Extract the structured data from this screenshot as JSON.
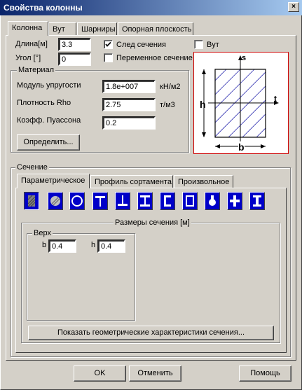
{
  "window": {
    "title": "Свойства колонны",
    "close_glyph": "×"
  },
  "top_tabs": [
    "Колонна",
    "Вут",
    "Шарниры",
    "Опорная плоскость"
  ],
  "column": {
    "length_label": "Длина[м]",
    "length_value": "3.3",
    "angle_label": "Угол [°]",
    "angle_value": "0",
    "trace_label": "След сечения",
    "trace_checked": true,
    "variable_label": "Переменное сечение",
    "variable_checked": false,
    "haunch_label": "Вут",
    "haunch_checked": false
  },
  "material": {
    "title": "Материал",
    "modulus_label": "Модуль упругости",
    "modulus_value": "1.8e+007",
    "modulus_unit": "кН/м2",
    "density_label": "Плотность Rho",
    "density_value": "2.75",
    "density_unit": "т/м3",
    "poisson_label": "Коэфф. Пуассона",
    "poisson_value": "0.2",
    "define_button": "Определить..."
  },
  "preview": {
    "h_label": "h",
    "b_label": "b",
    "s_label": "s",
    "t_label": "t",
    "border_color": "#cc0000"
  },
  "section": {
    "title": "Сечение",
    "tabs": [
      "Параметрическое",
      "Профиль сортамента",
      "Произвольное"
    ],
    "shape_icons": [
      "rectangle-icon",
      "circle-icon",
      "ring-icon",
      "t-section-icon",
      "inverted-t-icon",
      "i-beam-icon",
      "channel-icon",
      "box-icon",
      "cross-circle-icon",
      "cross-icon",
      "i-section-icon"
    ],
    "sizes_title": "Размеры сечения [м]",
    "top_title": "Верх",
    "b_label": "b",
    "b_value": "0.4",
    "h_label": "h",
    "h_value": "0.4",
    "geom_button": "Показать геометрические характеристики сечения..."
  },
  "footer": {
    "ok": "OK",
    "cancel": "Отменить",
    "help": "Помощь"
  }
}
